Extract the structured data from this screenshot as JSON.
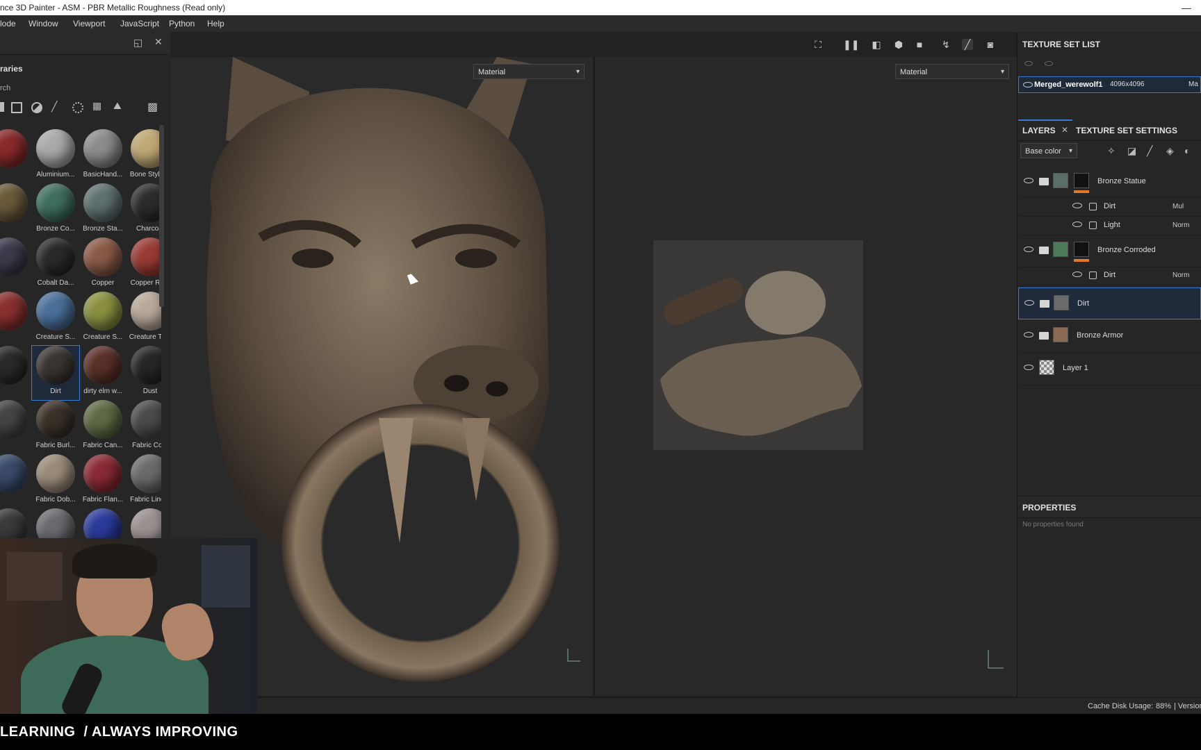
{
  "window": {
    "title": "nce 3D Painter - ASM - PBR Metallic Roughness (Read only)",
    "minimize_glyph": "—"
  },
  "menu": [
    "lode",
    "Window",
    "Viewport",
    "JavaScript",
    "Python",
    "Help"
  ],
  "shelf": {
    "title": "raries",
    "search_label": "rch",
    "materials": [
      {
        "label": "",
        "color": "#8a2a2a"
      },
      {
        "label": "Aluminium...",
        "color": "#a9a9a9"
      },
      {
        "label": "BasicHand...",
        "color": "#8c8c8c"
      },
      {
        "label": "Bone Styliz...",
        "color": "#bfa874"
      },
      {
        "label": "",
        "color": "#6a5a3a"
      },
      {
        "label": "Bronze Co...",
        "color": "#3f6f5c"
      },
      {
        "label": "Bronze Sta...",
        "color": "#5f7070"
      },
      {
        "label": "Charcoal",
        "color": "#2c2c2c"
      },
      {
        "label": "",
        "color": "#3a3a4a"
      },
      {
        "label": "Cobalt Da...",
        "color": "#2a2a2a"
      },
      {
        "label": "Copper",
        "color": "#8a5a48"
      },
      {
        "label": "Copper Re...",
        "color": "#9a3a34"
      },
      {
        "label": "",
        "color": "#8a3030"
      },
      {
        "label": "Creature S...",
        "color": "#4a6f9a"
      },
      {
        "label": "Creature S...",
        "color": "#8a9040"
      },
      {
        "label": "Creature Te...",
        "color": "#b8a89a"
      },
      {
        "label": "",
        "color": "#2a2a2a"
      },
      {
        "label": "Dirt",
        "color": "#3a3532"
      },
      {
        "label": "dirty elm w...",
        "color": "#5a3028"
      },
      {
        "label": "Dust",
        "color": "#262626"
      },
      {
        "label": "",
        "color": "#444"
      },
      {
        "label": "Fabric Burl...",
        "color": "#3a3028"
      },
      {
        "label": "Fabric Can...",
        "color": "#5e6a44"
      },
      {
        "label": "Fabric Co...",
        "color": "#4a4a4a"
      },
      {
        "label": "",
        "color": "#3a4a6a"
      },
      {
        "label": "Fabric Dob...",
        "color": "#9a8a78"
      },
      {
        "label": "Fabric Flan...",
        "color": "#8a2a34"
      },
      {
        "label": "Fabric Line...",
        "color": "#6a6a6a"
      },
      {
        "label": "",
        "color": "#3a3a3a"
      },
      {
        "label": "",
        "color": "#6a6a70"
      },
      {
        "label": "",
        "color": "#2a3a9a"
      },
      {
        "label": "",
        "color": "#9a9090"
      }
    ],
    "selected_index": 17
  },
  "viewport": {
    "left_mode": "Material",
    "right_mode": "Material"
  },
  "texture_set_list": {
    "title": "TEXTURE SET LIST",
    "item_name": "Merged_werewolf1",
    "item_size": "4096x4096",
    "item_extra": "Ma"
  },
  "layers_panel": {
    "tab_layers": "LAYERS",
    "tab_settings": "TEXTURE SET SETTINGS",
    "channel": "Base color",
    "layers": [
      {
        "name": "Bronze Statue",
        "type": "folder"
      },
      {
        "name": "Dirt",
        "type": "effect",
        "blend": "Mul"
      },
      {
        "name": "Light",
        "type": "effect",
        "blend": "Norm"
      },
      {
        "name": "Bronze Corroded",
        "type": "folder"
      },
      {
        "name": "Dirt",
        "type": "effect",
        "blend": "Norm"
      },
      {
        "name": "Dirt",
        "type": "folder"
      },
      {
        "name": "Bronze Armor",
        "type": "folder"
      },
      {
        "name": "Layer 1",
        "type": "layer"
      }
    ]
  },
  "properties": {
    "title": "PROPERTIES",
    "empty_text": "No properties found"
  },
  "status": {
    "cache": "Cache Disk Usage:",
    "cache_value": "88%",
    "version": "| Version"
  },
  "banner": {
    "text": "LEARNING  / ALWAYS IMPROVING"
  },
  "colors": {
    "accent": "#3b7bd6",
    "mask_orange": "#e07a2a"
  }
}
